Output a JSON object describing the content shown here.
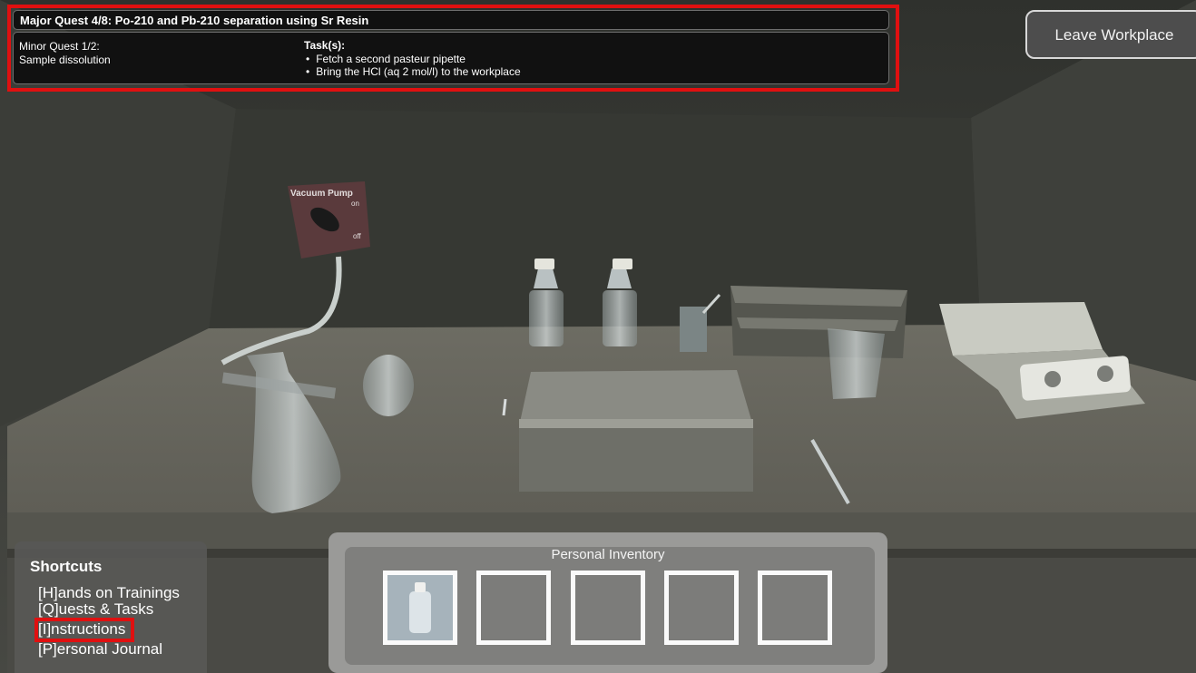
{
  "quest": {
    "major": "Major Quest 4/8:  Po-210 and Pb-210 separation using Sr Resin",
    "minor_title": "Minor Quest 1/2:",
    "minor_name": "Sample dissolution",
    "tasks_heading": "Task(s):",
    "tasks": [
      "Fetch a second pasteur pipette",
      "Bring the HCl (aq 2 mol/l) to the workplace"
    ]
  },
  "leave_button": "Leave Workplace",
  "scene": {
    "pump_label": "Vacuum Pump",
    "pump_on": "on",
    "pump_off": "off"
  },
  "shortcuts": {
    "title": "Shortcuts",
    "items": [
      "[H]ands on Trainings",
      "[Q]uests & Tasks",
      "[I]nstructions",
      "[P]ersonal Journal"
    ]
  },
  "inventory": {
    "title": "Personal Inventory",
    "slots": [
      "bottle",
      "",
      "",
      "",
      ""
    ]
  },
  "colors": {
    "highlight": "#e01010",
    "panel_bg": "#111111"
  }
}
